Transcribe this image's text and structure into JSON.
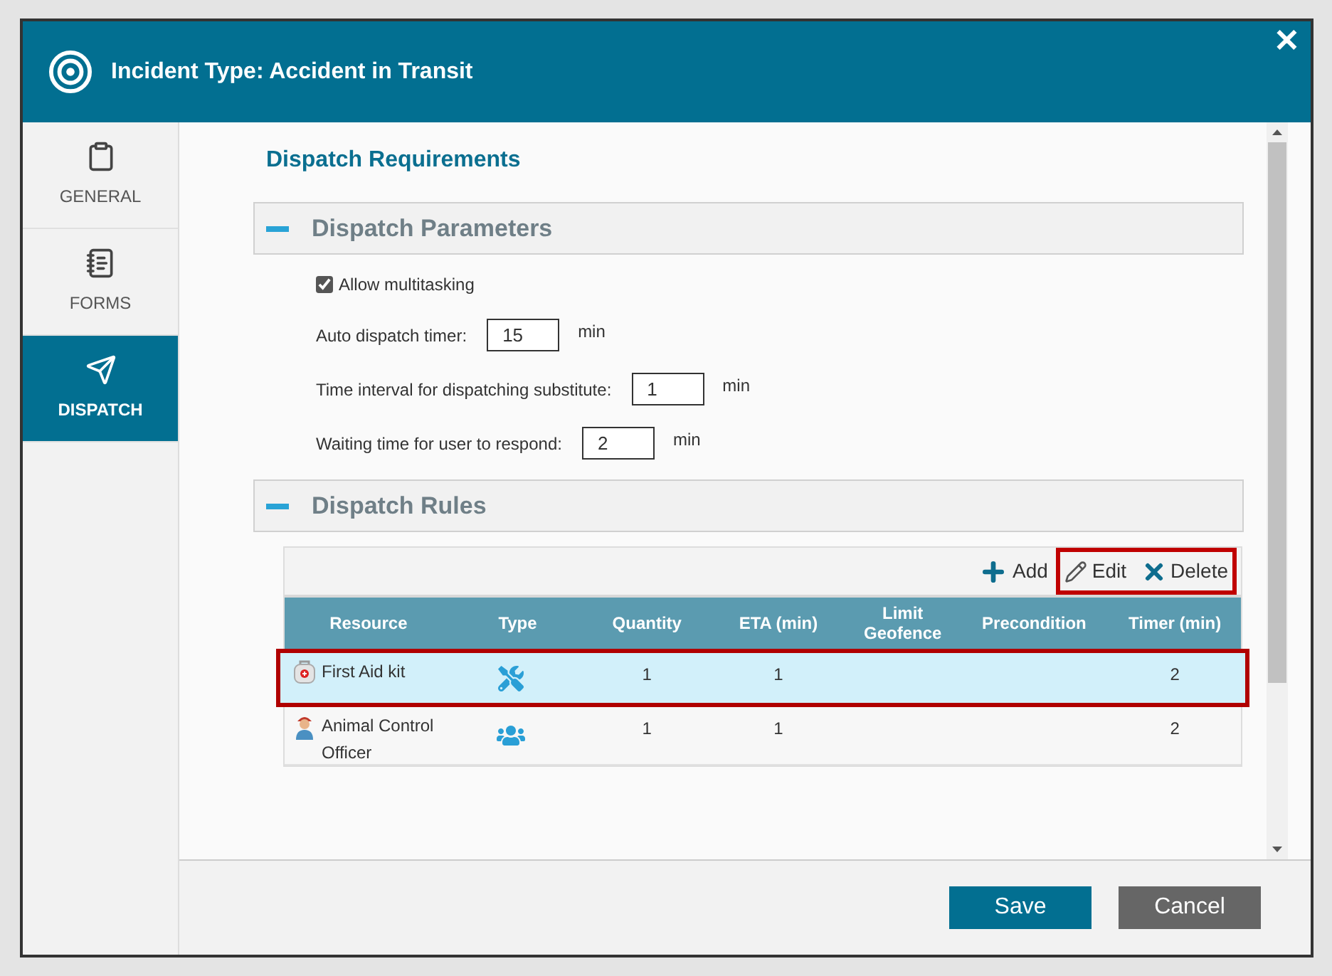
{
  "dialog": {
    "title": "Incident Type: Accident in Transit",
    "close": "✕"
  },
  "sidebar": {
    "items": [
      {
        "label": "GENERAL",
        "kind": "clipboard",
        "selected": false
      },
      {
        "label": "FORMS",
        "kind": "notepad",
        "selected": false
      },
      {
        "label": "DISPATCH",
        "kind": "send",
        "selected": true
      }
    ]
  },
  "heading": "Dispatch Requirements",
  "parameters": {
    "title": "Dispatch Parameters",
    "expanded": true,
    "multitasking": {
      "label": "Allow multitasking",
      "checked": true
    },
    "fields": [
      {
        "label": "Auto dispatch timer:",
        "value": "15",
        "unit": "min"
      },
      {
        "label": "Time interval for dispatching substitute:",
        "value": "1",
        "unit": "min"
      },
      {
        "label": "Waiting time for user to respond:",
        "value": "2",
        "unit": "min"
      }
    ]
  },
  "rules": {
    "title": "Dispatch Rules",
    "expanded": true,
    "toolbar": [
      {
        "kind": "add",
        "label": "Add",
        "outlined": false
      },
      {
        "kind": "edit",
        "label": "Edit",
        "outlined": true
      },
      {
        "kind": "delete",
        "label": "Delete",
        "outlined": true
      }
    ],
    "columns": [
      "Resource",
      "Type",
      "Quantity",
      "ETA (min)",
      "Limit Geofence",
      "Precondition",
      "Timer (min)"
    ],
    "rows": [
      {
        "resource": {
          "text": "First Aid kit",
          "kind": "kit"
        },
        "type": {
          "kind": "equipment"
        },
        "quantity": "1",
        "eta": "1",
        "timer": "2",
        "selected": true,
        "outlined": true
      },
      {
        "resource": {
          "text": "Animal Control Officer",
          "kind": "person"
        },
        "type": {
          "kind": "personnel"
        },
        "quantity": "1",
        "eta": "1",
        "timer": "2",
        "selected": false,
        "outlined": false
      }
    ]
  },
  "footer": {
    "buttons": [
      {
        "label": "Save",
        "kind": "primary"
      },
      {
        "label": "Cancel",
        "kind": "secondary"
      }
    ]
  }
}
